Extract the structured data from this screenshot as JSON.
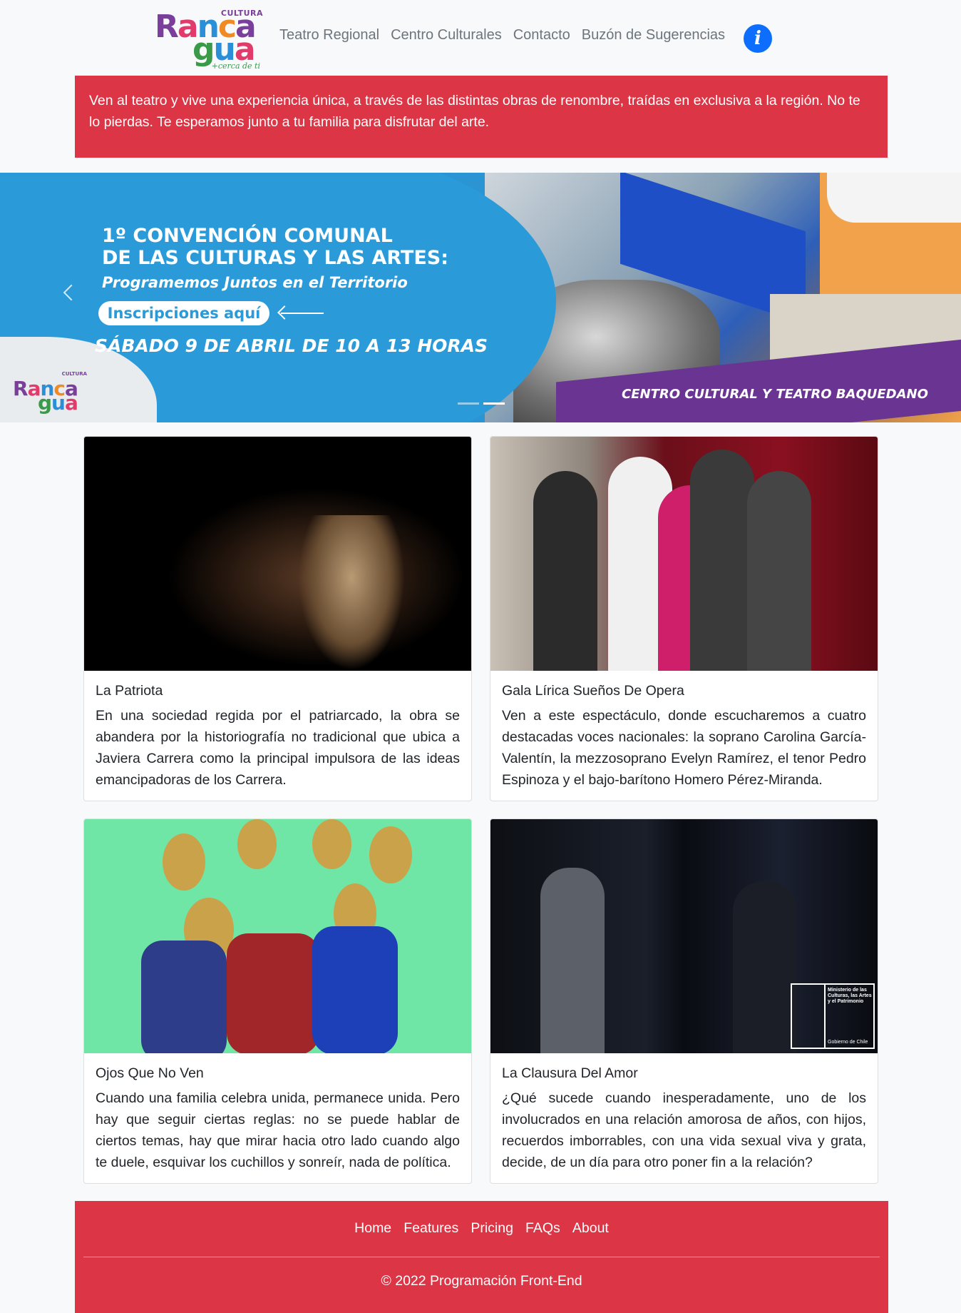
{
  "brand": {
    "logo_small": "CULTURA",
    "logo_main_1": "Ranca",
    "logo_main_2": "gua",
    "logo_tagline": "+cerca de ti"
  },
  "nav": {
    "items": [
      "Teatro Regional",
      "Centro Culturales",
      "Contacto",
      "Buzón de Sugerencias"
    ],
    "info_label": "i"
  },
  "alert": {
    "text": "Ven al teatro y vive una experiencia única, a través de las distintas obras de renombre, traídas en exclusiva a la región. No te lo pierdas. Te esperamos junto a tu familia para disfrutar del arte."
  },
  "carousel": {
    "line1": "1º CONVENCIÓN COMUNAL",
    "line2": "DE LAS CULTURAS Y LAS ARTES:",
    "line3": "Programemos Juntos en el Territorio",
    "button": "Inscripciones aquí",
    "line4": "SÁBADO 9 DE ABRIL DE 10 A 13 HORAS",
    "footer_text": "CENTRO CULTURAL Y TEATRO BAQUEDANO",
    "slides_count": 2,
    "active_slide": 2
  },
  "cards": [
    {
      "title": "La Patriota",
      "text": "En una sociedad regida por el patriarcado, la obra se abandera por la historiografía no tradicional que ubica a Javiera Carrera como la principal impulsora de las ideas emancipadoras de los Carrera."
    },
    {
      "title": "Gala Lírica Sueños De Opera",
      "text": "Ven a este espectáculo, donde escucharemos a cuatro destacadas voces nacionales: la soprano Carolina García-Valentín, la mezzosoprano Evelyn Ramírez, el tenor Pedro Espinoza y el bajo-barítono Homero Pérez-Miranda."
    },
    {
      "title": "Ojos Que No Ven",
      "text": "Cuando una familia celebra unida, permanece unida. Pero hay que seguir ciertas reglas: no se puede hablar de ciertos temas, hay que mirar hacia otro lado cuando algo te duele, esquivar los cuchillos y sonreír, nada de política."
    },
    {
      "title": "La Clausura Del Amor",
      "text": "¿Qué sucede cuando inesperadamente, uno de los involucrados en una relación amorosa de años, con hijos, recuerdos imborrables, con una vida sexual viva y grata, decide, de un día para otro poner fin a la relación?",
      "badge_text": "Ministerio de las Culturas, las Artes y el Patrimonio",
      "badge_sub": "Gobierno de Chile"
    }
  ],
  "footer": {
    "links": [
      "Home",
      "Features",
      "Pricing",
      "FAQs",
      "About"
    ],
    "copyright": "© 2022 Programación Front-End"
  },
  "colors": {
    "primary_red": "#dc3545",
    "info_blue": "#0d6efd",
    "carousel_blue": "#2a9ad8",
    "carousel_purple": "#6a3592"
  }
}
